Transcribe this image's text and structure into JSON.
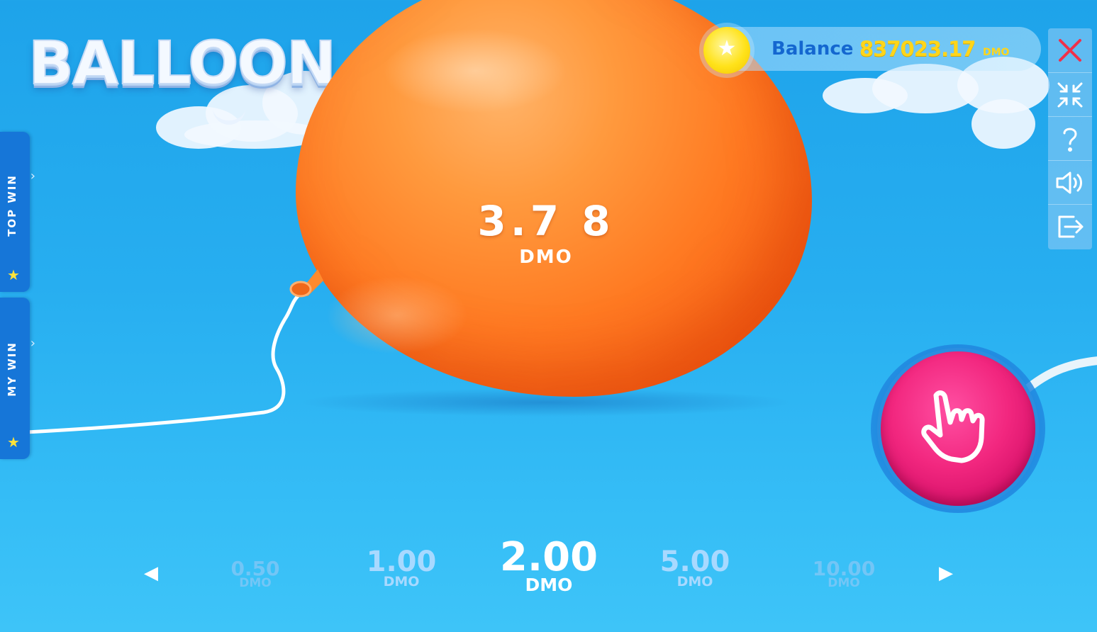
{
  "game": {
    "logo_text": "BALLOON"
  },
  "balloon": {
    "multiplier": "3.7 8",
    "unit": "DMO",
    "color": "#ff7a22"
  },
  "side_tabs": [
    {
      "label": "TOP WIN",
      "icon": "star-icon"
    },
    {
      "label": "MY WIN",
      "icon": "star-icon"
    }
  ],
  "balance": {
    "label": "Balance",
    "value": "837023.17",
    "unit": "DMO",
    "accent": "#ffd51a"
  },
  "toolbar": [
    {
      "icon": "close-icon"
    },
    {
      "icon": "minimize-icon"
    },
    {
      "icon": "help-icon"
    },
    {
      "icon": "sound-icon"
    },
    {
      "icon": "exit-icon"
    }
  ],
  "action_button": {
    "icon": "hand-pointer-icon",
    "color": "#f2277f"
  },
  "bets": [
    {
      "value": "0.50",
      "unit": "DMO"
    },
    {
      "value": "1.00",
      "unit": "DMO"
    },
    {
      "value": "2.00",
      "unit": "DMO"
    },
    {
      "value": "5.00",
      "unit": "DMO"
    },
    {
      "value": "10.00",
      "unit": "DMO"
    }
  ],
  "bet_selected": "2.00"
}
